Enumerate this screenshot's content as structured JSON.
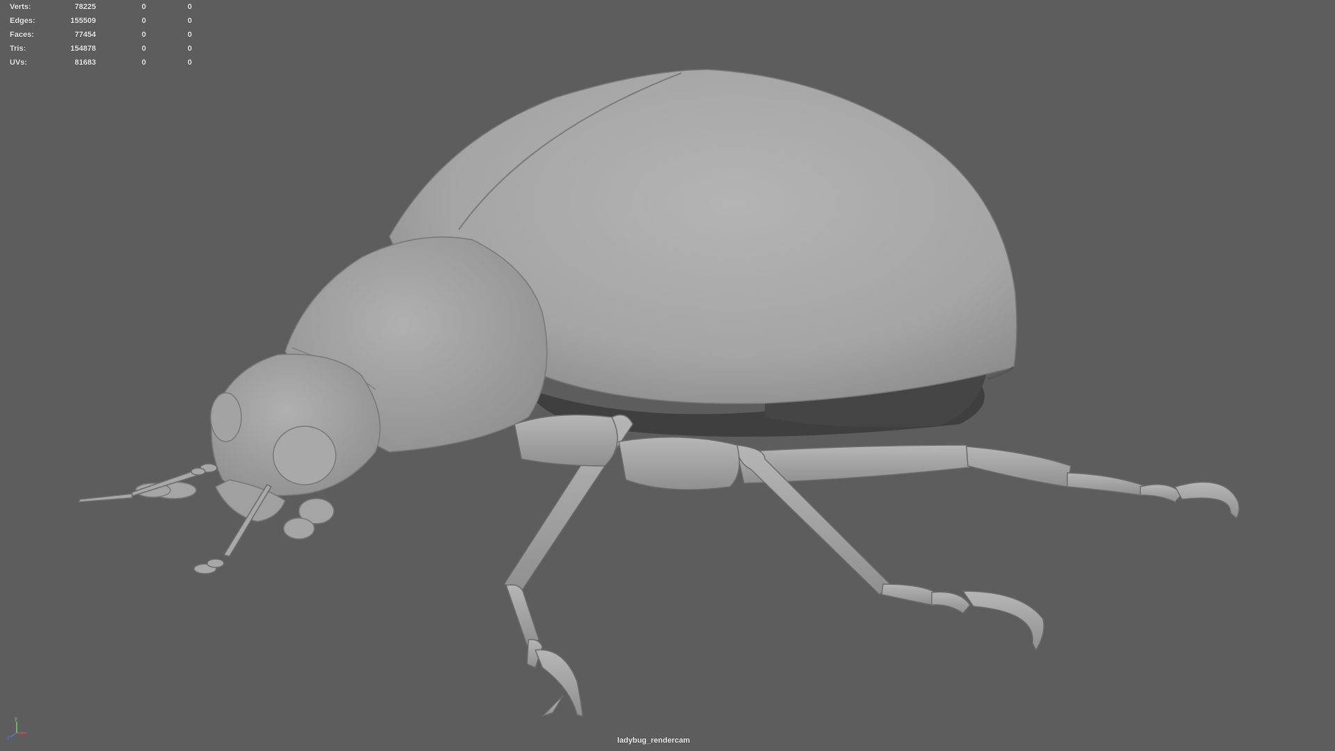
{
  "hud": {
    "stats": [
      {
        "label": "Verts:",
        "total": "78225",
        "selected": "0",
        "component": "0"
      },
      {
        "label": "Edges:",
        "total": "155509",
        "selected": "0",
        "component": "0"
      },
      {
        "label": "Faces:",
        "total": "77454",
        "selected": "0",
        "component": "0"
      },
      {
        "label": "Tris:",
        "total": "154878",
        "selected": "0",
        "component": "0"
      },
      {
        "label": "UVs:",
        "total": "81683",
        "selected": "0",
        "component": "0"
      }
    ]
  },
  "camera": {
    "name": "ladybug_rendercam"
  },
  "axis_gizmo": {
    "x_color": "#e04a4a",
    "y_color": "#6fd36f",
    "z_color": "#4a7ae0"
  },
  "colors": {
    "background": "#5d5d5d",
    "model": "#a7a7a7",
    "hud_text": "#f0f0f0"
  }
}
